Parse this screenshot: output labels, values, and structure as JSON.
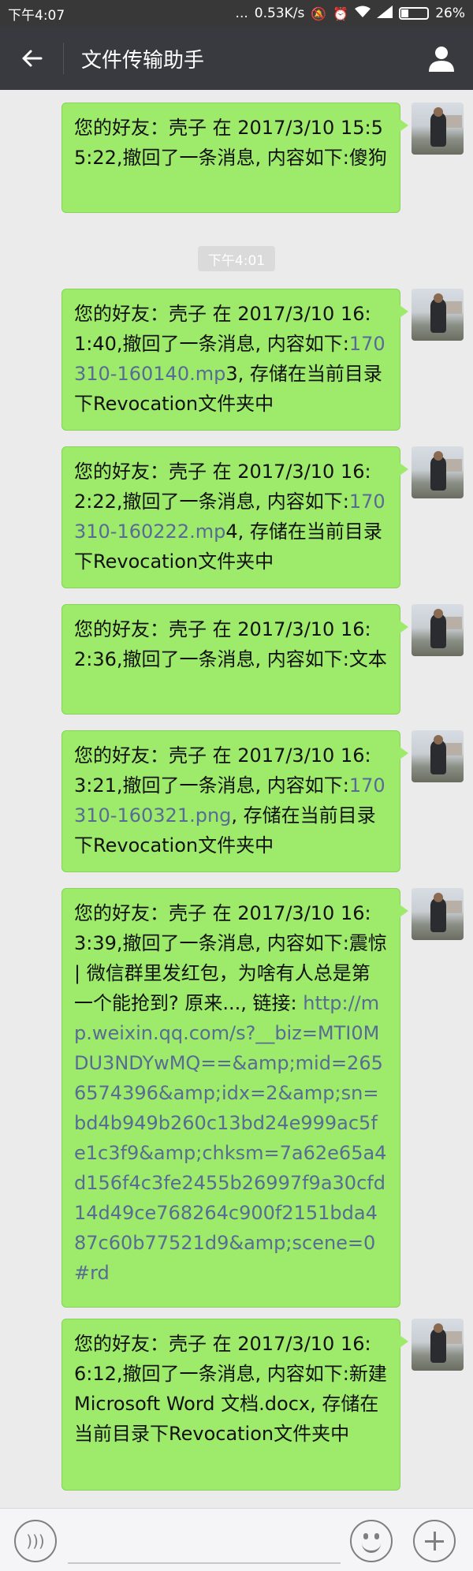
{
  "status_bar": {
    "time": "下午4:07",
    "dots": "...",
    "net_speed": "0.53K/s",
    "signal_icon": "signal-icon",
    "battery_percent": "26%",
    "battery_level": 0.26
  },
  "header": {
    "title": "文件传输助手",
    "back_icon": "back-arrow-icon",
    "user_icon": "user-icon"
  },
  "timestamp": "下午4:01",
  "messages": [
    {
      "parts": [
        {
          "t": "您的好友：壳子 在 2017/3/10 15:55:22,撤回了一条消息, 内容如下:傻狗",
          "link": false
        }
      ]
    },
    {
      "parts": [
        {
          "t": "您的好友：壳子 在 2017/3/10 16:1:40,撤回了一条消息, 内容如下:",
          "link": false
        },
        {
          "t": "170310-160140.mp",
          "link": true
        },
        {
          "t": "3, 存储在当前目录下Revocation文件夹中",
          "link": false
        }
      ]
    },
    {
      "parts": [
        {
          "t": "您的好友：壳子 在 2017/3/10 16:2:22,撤回了一条消息, 内容如下:",
          "link": false
        },
        {
          "t": "170310-160222.mp",
          "link": true
        },
        {
          "t": "4, 存储在当前目录下Revocation文件夹中",
          "link": false
        }
      ]
    },
    {
      "parts": [
        {
          "t": "您的好友：壳子 在 2017/3/10 16:2:36,撤回了一条消息, 内容如下:文本",
          "link": false
        }
      ]
    },
    {
      "parts": [
        {
          "t": "您的好友：壳子 在 2017/3/10 16:3:21,撤回了一条消息, 内容如下:",
          "link": false
        },
        {
          "t": "170310-160321.png",
          "link": true
        },
        {
          "t": ", 存储在当前目录下Revocation文件夹中",
          "link": false
        }
      ]
    },
    {
      "parts": [
        {
          "t": "您的好友：壳子 在 2017/3/10 16:3:39,撤回了一条消息, 内容如下:震惊 | 微信群里发红包，为啥有人总是第一个能抢到? 原来..., 链接: ",
          "link": false
        },
        {
          "t": "http://mp.weixin.qq.com/s?__biz=MTI0MDU3NDYwMQ==&amp;mid=2656574396&amp;idx=2&amp;sn=bd4b949b260c13bd24e999ac5fe1c3f9&amp;chksm=7a62e65a4d156f4c3fe2455b26997f9a30cfd14d49ce768264c900f2151bda487c60b77521d9&amp;scene=0#rd",
          "link": true
        }
      ]
    },
    {
      "parts": [
        {
          "t": "您的好友：壳子 在 2017/3/10 16:6:12,撤回了一条消息, 内容如下:新建 Microsoft Word 文档.docx, 存储在当前目录下Revocation文件夹中",
          "link": false
        }
      ]
    }
  ],
  "input_bar": {
    "voice_icon": "voice-icon",
    "emoji_icon": "emoji-icon",
    "plus_icon": "plus-icon"
  }
}
